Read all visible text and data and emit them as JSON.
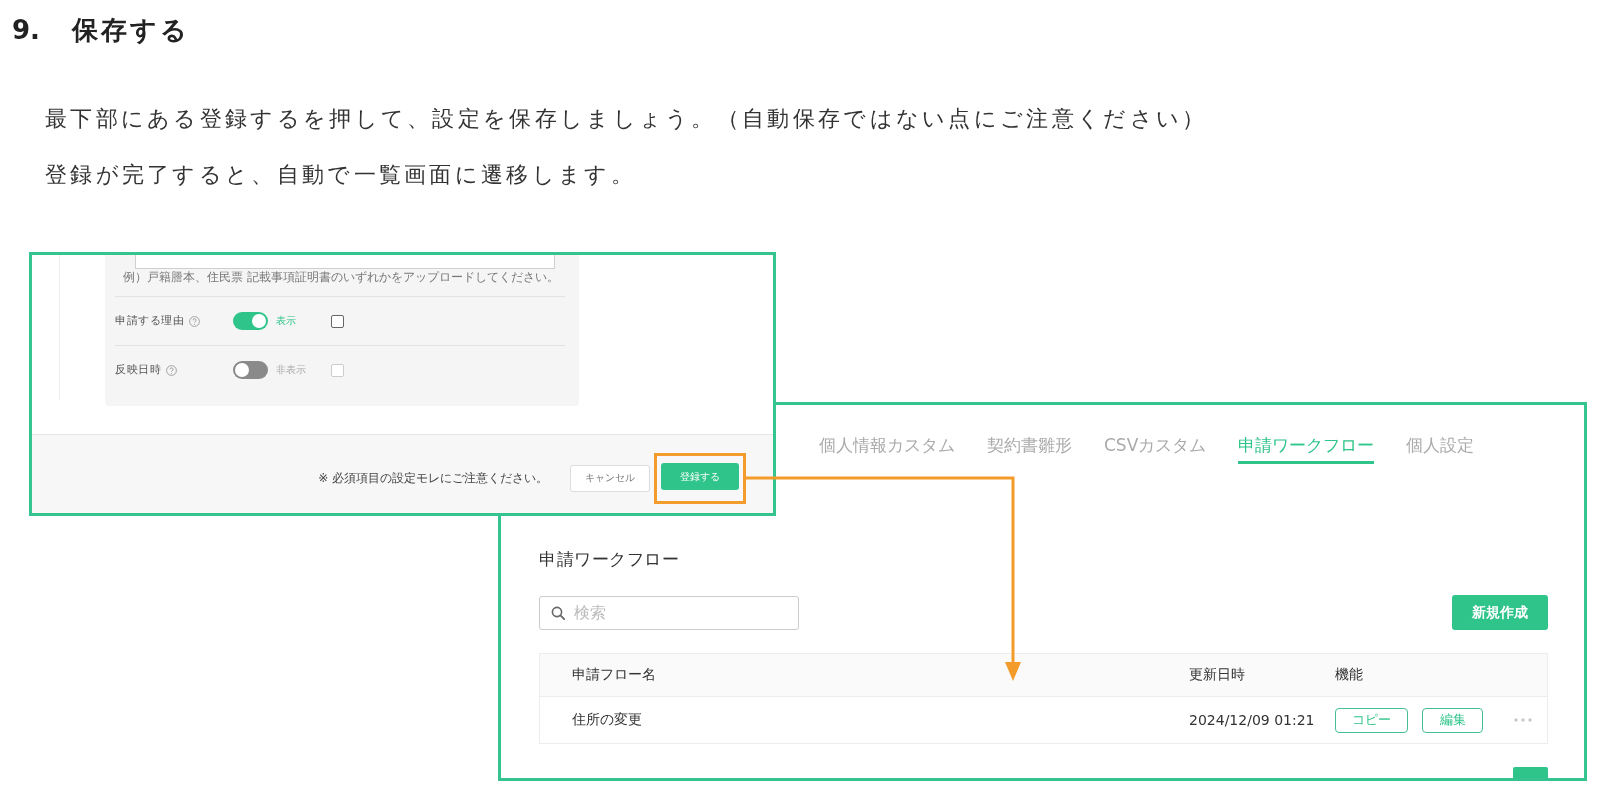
{
  "heading": {
    "number": "9.",
    "title": "保存する"
  },
  "paragraphs": [
    "最下部にある登録するを押して、設定を保存しましょう。（自動保存ではない点にご注意ください）",
    "登録が完了すると、自動で一覧画面に遷移します。"
  ],
  "form_screenshot": {
    "hint": "例）戸籍謄本、住民票 記載事項証明書のいずれかをアップロードしてください。",
    "rows": [
      {
        "label": "申請する理由",
        "on": true,
        "toggle_label": "表示",
        "checked": false
      },
      {
        "label": "反映日時",
        "on": false,
        "toggle_label": "非表示",
        "checked": false
      }
    ],
    "notice": "※ 必須項目の設定モレにご注意ください。",
    "buttons": [
      {
        "label": "キャンセル",
        "kind": "secondary",
        "highlighted": false
      },
      {
        "label": "登録する",
        "kind": "primary",
        "highlighted": true
      }
    ]
  },
  "list_screenshot": {
    "tabs": [
      {
        "label": "個人情報カスタム",
        "selected": false
      },
      {
        "label": "契約書雛形",
        "selected": false
      },
      {
        "label": "CSVカスタム",
        "selected": false
      },
      {
        "label": "申請ワークフロー",
        "selected": true
      },
      {
        "label": "個人設定",
        "selected": false
      }
    ],
    "title": "申請ワークフロー",
    "search": {
      "placeholder": "検索"
    },
    "new_button": "新規作成",
    "table": {
      "columns": [
        "申請フロー名",
        "更新日時",
        "機能"
      ],
      "rows": [
        {
          "name": "住所の変更",
          "updated": "2024/12/09 01:21",
          "actions": [
            "コピー",
            "編集"
          ]
        }
      ]
    }
  }
}
